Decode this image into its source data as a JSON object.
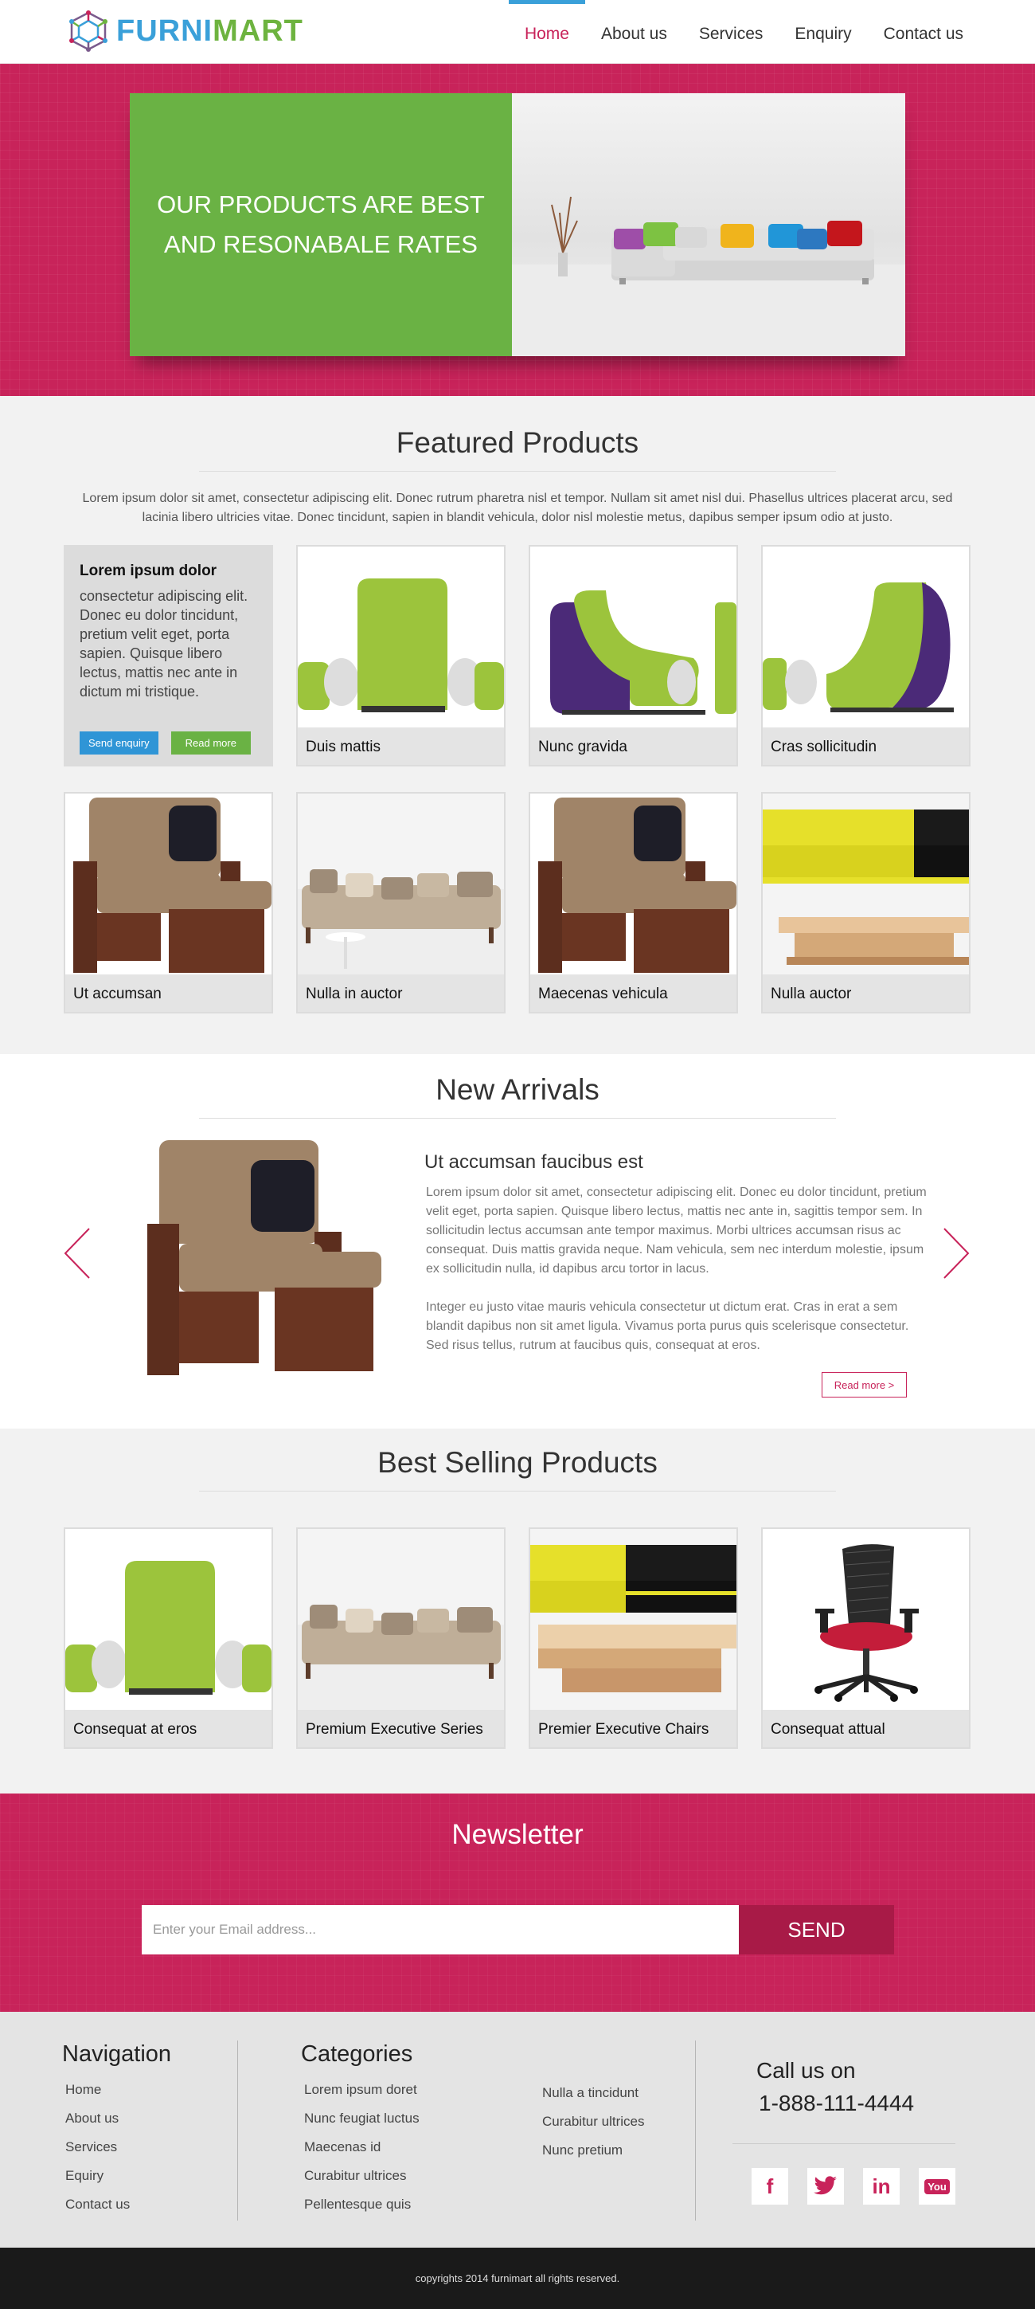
{
  "brand": {
    "name_part1": "FURNI",
    "name_part2": "MART",
    "blue": "#3aa0d9",
    "green": "#6db33f"
  },
  "nav": {
    "items": [
      {
        "label": "Home",
        "active": true
      },
      {
        "label": "About us"
      },
      {
        "label": "Services"
      },
      {
        "label": "Enquiry"
      },
      {
        "label": "Contact us"
      }
    ]
  },
  "hero": {
    "headline": "OUR PRODUCTS ARE BEST AND RESONABALE RATES",
    "slide_count": 4,
    "active_slide": 1,
    "accent": "#c8235a"
  },
  "featured": {
    "title": "Featured Products",
    "intro": "Lorem ipsum dolor sit amet, consectetur adipiscing elit. Donec rutrum pharetra nisl et tempor. Nullam sit amet nisl dui. Phasellus ultrices placerat arcu, sed lacinia libero ultricies vitae. Donec tincidunt, sapien in blandit vehicula, dolor nisl molestie metus, dapibus semper ipsum odio at justo.",
    "info_card": {
      "title": "Lorem ipsum dolor",
      "text": "consectetur adipiscing elit. Donec eu dolor tincidunt, pretium velit eget, porta sapien. Quisque libero lectus, mattis nec ante in dictum mi tristique.",
      "btn_enquiry": "Send enquiry",
      "btn_more": "Read more"
    },
    "products": [
      "Duis mattis",
      "Nunc gravida",
      "Cras sollicitudin",
      "Ut accumsan",
      "Nulla in auctor",
      "Maecenas vehicula",
      "Nulla auctor"
    ]
  },
  "arrivals": {
    "title": "New Arrivals",
    "item_title": "Ut accumsan faucibus est",
    "p1": "Lorem ipsum dolor sit amet, consectetur adipiscing elit. Donec eu dolor tincidunt, pretium velit eget, porta sapien. Quisque libero lectus, mattis nec ante in, sagittis tempor sem. In sollicitudin lectus accumsan ante tempor maximus. Morbi ultrices accumsan risus ac consequat. Duis mattis gravida neque. Nam vehicula, sem nec interdum molestie, ipsum ex sollicitudin nulla, id dapibus arcu tortor in lacus.",
    "p2": "Integer eu justo vitae mauris vehicula consectetur ut dictum erat. Cras in erat a sem blandit dapibus non sit amet ligula. Vivamus porta purus quis scelerisque consectetur. Sed risus tellus, rutrum at faucibus quis, consequat at eros.",
    "read_more": "Read more >"
  },
  "best": {
    "title": "Best Selling Products",
    "products": [
      "Consequat at eros",
      "Premium Executive Series",
      "Premier Executive Chairs",
      "Consequat attual"
    ]
  },
  "newsletter": {
    "title": "Newsletter",
    "placeholder": "Enter your Email address...",
    "button": "SEND"
  },
  "footer": {
    "nav_title": "Navigation",
    "nav_links": [
      "Home",
      "About us",
      "Services",
      "Equiry",
      "Contact us"
    ],
    "cat_title": "Categories",
    "cat_links_1": [
      "Lorem ipsum doret",
      "Nunc feugiat luctus",
      "Maecenas id",
      "Curabitur ultrices",
      "Pellentesque quis"
    ],
    "cat_links_2": [
      "Nulla a tincidunt",
      "Curabitur ultrices",
      "Nunc pretium"
    ],
    "call_title": "Call us on",
    "phone": "1-888-111-4444",
    "socials": [
      {
        "icon": "facebook-icon",
        "glyph": "f"
      },
      {
        "icon": "twitter-icon",
        "glyph": "t"
      },
      {
        "icon": "linkedin-icon",
        "glyph": "in"
      },
      {
        "icon": "youtube-icon",
        "glyph": "You"
      }
    ]
  },
  "copyright": "copyrights 2014 furnimart all rights reserved."
}
